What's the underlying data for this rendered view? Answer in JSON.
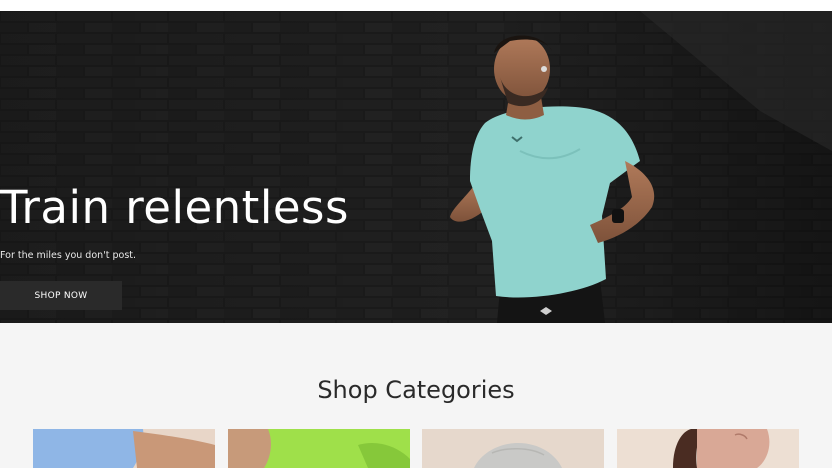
{
  "hero": {
    "title": "Train relentless",
    "subtitle": "For the miles you don't post.",
    "cta_label": "SHOP NOW"
  },
  "categories_section": {
    "title": "Shop Categories",
    "cards": [
      {
        "name": "category-card-1",
        "image": "man-in-blue-shirt"
      },
      {
        "name": "category-card-2",
        "image": "man-in-lime-shirt"
      },
      {
        "name": "category-card-3",
        "image": "grey-cap"
      },
      {
        "name": "category-card-4",
        "image": "woman-portrait"
      }
    ]
  },
  "colors": {
    "hero_bg": "#161616",
    "button_bg": "#2a2a2a",
    "page_bg": "#f5f5f5",
    "shirt": "#8fd3cd"
  }
}
